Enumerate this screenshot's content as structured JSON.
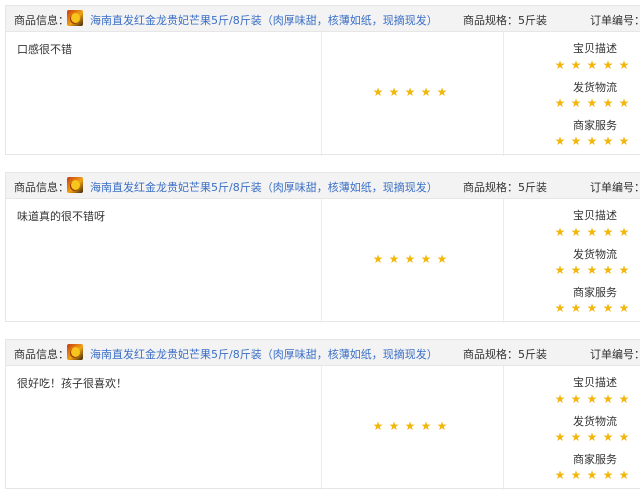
{
  "colors": {
    "accent_link": "#3b6fc6",
    "star": "#f2b70c",
    "header_bg": "#f3f3f3"
  },
  "icons": {
    "star": "★",
    "product_thumb": "mango-thumbnail"
  },
  "reviews": [
    {
      "header": {
        "product_label": "商品信息：",
        "product_name": "海南直发红金龙贵妃芒果5斤/8斤装（肉厚味甜，核薄如纸，现摘现发）",
        "spec": "商品规格：5斤装",
        "order_label": "订单编号："
      },
      "comment": "口感很不错",
      "overall_rating": 5,
      "ratings": [
        {
          "label": "宝贝描述",
          "stars": 5
        },
        {
          "label": "发货物流",
          "stars": 5
        },
        {
          "label": "商家服务",
          "stars": 5
        }
      ]
    },
    {
      "header": {
        "product_label": "商品信息：",
        "product_name": "海南直发红金龙贵妃芒果5斤/8斤装（肉厚味甜，核薄如纸，现摘现发）",
        "spec": "商品规格：5斤装",
        "order_label": "订单编号："
      },
      "comment": "味道真的很不错呀",
      "overall_rating": 5,
      "ratings": [
        {
          "label": "宝贝描述",
          "stars": 5
        },
        {
          "label": "发货物流",
          "stars": 5
        },
        {
          "label": "商家服务",
          "stars": 5
        }
      ]
    },
    {
      "header": {
        "product_label": "商品信息：",
        "product_name": "海南直发红金龙贵妃芒果5斤/8斤装（肉厚味甜，核薄如纸，现摘现发）",
        "spec": "商品规格：5斤装",
        "order_label": "订单编号："
      },
      "comment": "很好吃！孩子很喜欢！",
      "overall_rating": 5,
      "ratings": [
        {
          "label": "宝贝描述",
          "stars": 5
        },
        {
          "label": "发货物流",
          "stars": 5
        },
        {
          "label": "商家服务",
          "stars": 5
        }
      ]
    }
  ]
}
